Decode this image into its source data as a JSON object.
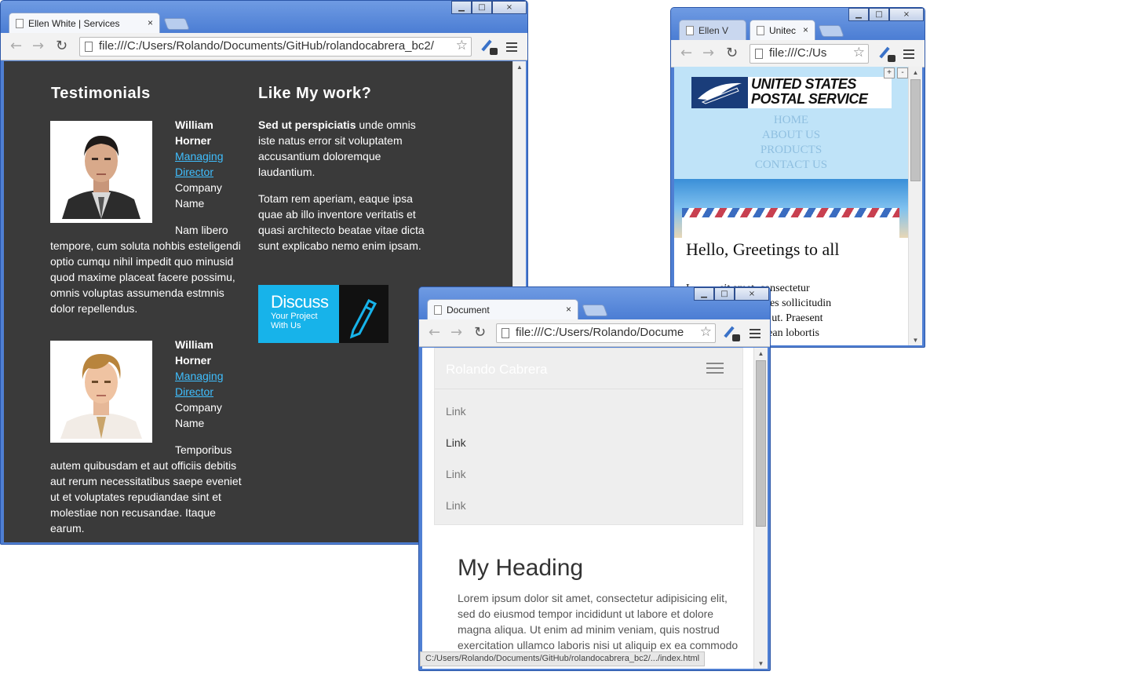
{
  "windowA": {
    "tab_title": "Ellen White | Services",
    "address": "file:///C:/Users/Rolando/Documents/GitHub/rolandocabrera_bc2/",
    "testimonials": {
      "heading": "Testimonials",
      "items": [
        {
          "name_line1": "William",
          "name_line2": "Horner",
          "role_line1": "Managing",
          "role_line2": "Director",
          "company_line1": "Company",
          "company_line2": "Name",
          "quote_first": "Nam libero",
          "quote_rest": "tempore, cum soluta nohbis esteligendi optio cumqu nihil impedit quo minusid quod maxime placeat facere possimu, omnis voluptas assumenda estmnis dolor repellendus."
        },
        {
          "name_line1": "William",
          "name_line2": "Horner",
          "role_line1": "Managing",
          "role_line2": "Director",
          "company_line1": "Company",
          "company_line2": "Name",
          "quote_first": "Temporibus",
          "quote_rest": "autem quibusdam et aut officiis debitis aut rerum necessitatibus saepe eveniet ut et voluptates repudiandae sint et molestiae non recusandae. Itaque earum."
        }
      ]
    },
    "like": {
      "heading": "Like My work?",
      "p1_bold": "Sed ut perspiciatis",
      "p1_rest": " unde omnis iste natus error sit voluptatem accusantium doloremque laudantium.",
      "p2": "Totam rem aperiam, eaque ipsa quae ab illo inventore veritatis et quasi architecto beatae vitae dicta sunt explicabo nemo enim ipsam.",
      "banner_big": "Discuss",
      "banner_small1": "Your Project",
      "banner_small2": "With Us"
    }
  },
  "windowB": {
    "tab1_title": "Ellen V",
    "tab2_title": "Unitec",
    "address": "file:///C:/Us",
    "logo_line1": "UNITED STATES",
    "logo_line2": "POSTAL SERVICE",
    "nav": [
      "HOME",
      "ABOUT US",
      "PRODUCTS",
      "CONTACT US"
    ],
    "zoom_in": "+",
    "zoom_out": "-",
    "greeting": "Hello, Greetings to all",
    "body_lines": [
      "L          sit amet, consectetur",
      "            sellus sodales sollicitudin",
      "            consectetur ut. Praesent",
      "            lorem. Aenean lobortis"
    ]
  },
  "windowC": {
    "tab_title": "Document",
    "address": "file:///C:/Users/Rolando/Docume",
    "brand": "Rolando Cabrera",
    "links": [
      "Link",
      "Link",
      "Link",
      "Link"
    ],
    "heading": "My Heading",
    "paragraph": "Lorem ipsum dolor sit amet, consectetur adipisicing elit, sed do eiusmod tempor incididunt ut labore et dolore magna aliqua. Ut enim ad minim veniam, quis nostrud exercitation ullamco laboris nisi ut aliquip ex ea commodo",
    "status": "C:/Users/Rolando/Documents/GitHub/rolandocabrera_bc2/.../index.html"
  },
  "icons": {
    "back": "←",
    "forward": "→",
    "reload": "↻",
    "star": "☆",
    "close": "×",
    "minimize": "▁",
    "maximize": "□",
    "scroll_up": "▲",
    "scroll_down": "▼"
  },
  "colors": {
    "chrome_frame": "#4f7fd3",
    "dark_bg": "#3a3a3a",
    "link_blue": "#3fbfff",
    "discuss_blue": "#17b3ea",
    "usps_nav_bg": "#bfe3f8"
  }
}
